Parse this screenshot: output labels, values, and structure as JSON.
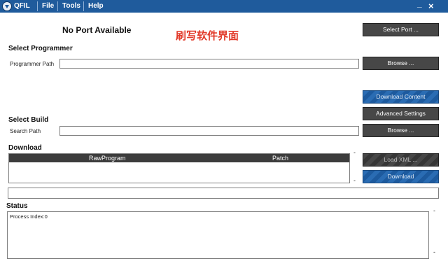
{
  "window": {
    "app_title": "QFIL",
    "menu": [
      "File",
      "Tools",
      "Help"
    ],
    "minimize": "_",
    "close": "×"
  },
  "header": {
    "port_status": "No Port Available",
    "annotation": "刷写软件界面",
    "select_port": "Select Port ..."
  },
  "programmer": {
    "section": "Select Programmer",
    "path_label": "Programmer Path",
    "path_value": "",
    "browse": "Browse ..."
  },
  "actions": {
    "download_content": "Download Content",
    "advanced_settings": "Advanced Settings"
  },
  "build": {
    "section": "Select Build",
    "search_label": "Search Path",
    "search_value": "",
    "browse": "Browse ..."
  },
  "download": {
    "section": "Download",
    "columns": [
      "RawProgram",
      "Patch"
    ],
    "load_xml": "Load XML ...",
    "download_button": "Download",
    "dash": "-"
  },
  "status": {
    "section": "Status",
    "log": "Process Index:0",
    "dash": "-"
  }
}
